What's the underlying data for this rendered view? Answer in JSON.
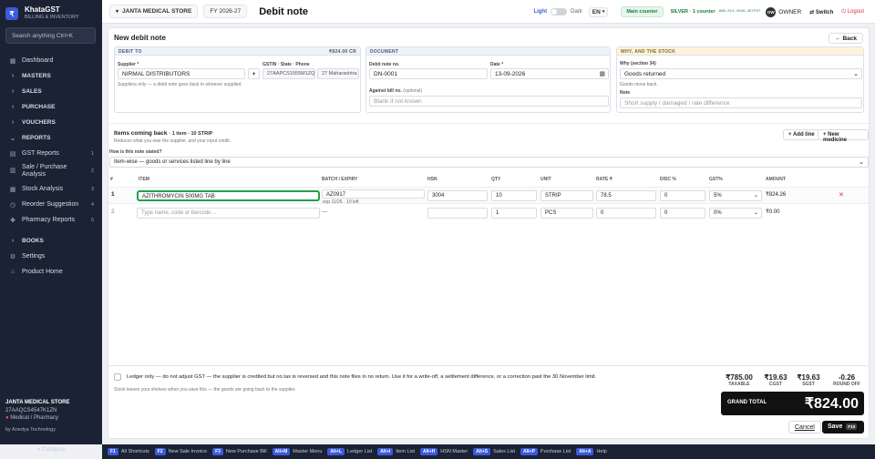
{
  "brand": {
    "name": "KhataGST",
    "subtitle": "BILLING & INVENTORY",
    "logo_letter": "₹"
  },
  "sidebar": {
    "search_placeholder": "Search anything   Ctrl+K",
    "items": [
      {
        "icon": "▦",
        "label": "Dashboard",
        "count": ""
      },
      {
        "icon": "›",
        "label": "MASTERS",
        "count": ""
      },
      {
        "icon": "›",
        "label": "SALES",
        "count": ""
      },
      {
        "icon": "›",
        "label": "PURCHASE",
        "count": ""
      },
      {
        "icon": "›",
        "label": "VOUCHERS",
        "count": ""
      },
      {
        "icon": "⌄",
        "label": "REPORTS",
        "count": ""
      },
      {
        "icon": "▤",
        "label": "GST Reports",
        "count": "1"
      },
      {
        "icon": "▥",
        "label": "Sale / Purchase Analysis",
        "count": "2"
      },
      {
        "icon": "▦",
        "label": "Stock Analysis",
        "count": "3"
      },
      {
        "icon": "◷",
        "label": "Reorder Suggestion",
        "count": "4"
      },
      {
        "icon": "✚",
        "label": "Pharmacy Reports",
        "count": "5"
      },
      {
        "icon": "›",
        "label": "BOOKS",
        "count": ""
      },
      {
        "icon": "⚙",
        "label": "Settings",
        "count": ""
      },
      {
        "icon": "⌂",
        "label": "Product Home",
        "count": ""
      }
    ],
    "company": "JANTA MEDICAL STORE",
    "gstin": "27AAQCS4547K1ZN",
    "type": "Medical / Pharmacy",
    "by": "by Anedya Technology",
    "collapse": "« Collapse"
  },
  "topbar": {
    "company": "JANTA MEDICAL STORE",
    "fy": "FY 2026-27",
    "title": "Debit note",
    "light": "Light",
    "dark": "Dark",
    "lang": "EN",
    "counter": "Main counter",
    "plan": "SILVER · 1 counter",
    "code": "AND-SLV-2026-4E7F07",
    "avatar": "OW",
    "role": "OWNER",
    "switch": "⇄ Switch",
    "logout": "⏻ Logout"
  },
  "form": {
    "heading": "New debit note",
    "back": "← Back",
    "debit_to": {
      "head": "DEBIT TO",
      "amount": "₹824.00 CR",
      "supplier_label": "Supplier *",
      "supplier": "NIRMAL DISTRIBUTORS",
      "add": "+",
      "gstin_label": "GSTIN · State · Phone",
      "gstin": "27AAPCS1555M1ZQ",
      "state": "27 Maharashtra",
      "hint": "Suppliers only — a debit note goes back to whoever supplied."
    },
    "document": {
      "head": "DOCUMENT",
      "no_label": "Debit note no.",
      "no": "DN-0001",
      "date_label": "Date *",
      "date": "13-09-2026",
      "against_label": "Against bill no.",
      "against_optional": "(optional)",
      "against_placeholder": "Blank if not known"
    },
    "why": {
      "head": "WHY, AND THE STOCK",
      "section_label": "Why (section 34)",
      "section": "Goods returned",
      "section_hint": "Goods move back.",
      "note_label": "Note",
      "note_placeholder": "Short supply / damaged / rate difference"
    },
    "items": {
      "heading": "Items coming back",
      "summary": "· 1 item · 10 STRIP",
      "sub": "Reduces what you owe the supplier, and your input credit.",
      "add_line": "+ Add line",
      "new_medicine": "+ New medicine",
      "stated_label": "How is this note stated?",
      "stated": "Item-wise — goods or services listed line by line",
      "columns": [
        "#",
        "ITEM",
        "BATCH / EXPIRY",
        "HSN",
        "QTY",
        "UNIT",
        "RATE ₹",
        "DISC %",
        "GST%",
        "AMOUNT"
      ],
      "rows": [
        {
          "n": "1",
          "item": "AZITHROMYCIN 500MG TAB",
          "batch": "AZ0917",
          "expiry": "exp 11/26 · 10 left",
          "hsn": "3004",
          "qty": "10",
          "unit": "STRIP",
          "rate": "78.5",
          "disc": "0",
          "gst": "5%",
          "amount": "₹824.26",
          "remove": "✕"
        },
        {
          "n": "2",
          "item": "",
          "item_placeholder": "Type name, code or barcode…",
          "batch": "—",
          "expiry": "",
          "hsn": "",
          "qty": "1",
          "unit": "PCS",
          "rate": "0",
          "disc": "0",
          "gst": "0%",
          "amount": "₹0.00",
          "remove": ""
        }
      ]
    },
    "ledger": {
      "text": "Ledger only — do not adjust GST — the supplier is credited but no tax is reversed and this note files in no return. Use it for a write-off, a settlement difference, or a correction past the 30 November limit.",
      "sub": "Stock leaves your shelves when you save this — the goods are going back to the supplier."
    },
    "totals": [
      {
        "value": "₹785.00",
        "label": "TAXABLE"
      },
      {
        "value": "₹19.63",
        "label": "CGST"
      },
      {
        "value": "₹19.63",
        "label": "SGST"
      },
      {
        "value": "-0.26",
        "label": "ROUND OFF"
      }
    ],
    "grand_label": "GRAND TOTAL",
    "grand_value": "₹824.00",
    "cancel": "Cancel",
    "save": "Save",
    "save_key": "F10"
  },
  "shortcuts": [
    {
      "key": "F1",
      "label": "All Shortcuts"
    },
    {
      "key": "F2",
      "label": "New Sale Invoice"
    },
    {
      "key": "F3",
      "label": "New Purchase Bill"
    },
    {
      "key": "Alt+M",
      "label": "Master Menu"
    },
    {
      "key": "Alt+L",
      "label": "Ledger List"
    },
    {
      "key": "Alt+I",
      "label": "Item List"
    },
    {
      "key": "Alt+H",
      "label": "HSN Master"
    },
    {
      "key": "Alt+S",
      "label": "Sales List"
    },
    {
      "key": "Alt+P",
      "label": "Purchase List"
    },
    {
      "key": "Alt+A",
      "label": "Help"
    }
  ],
  "colors": {
    "sidebar": "#1a2233",
    "accent": "#3b5bdb",
    "focus": "#22a04a",
    "danger": "#d33"
  }
}
